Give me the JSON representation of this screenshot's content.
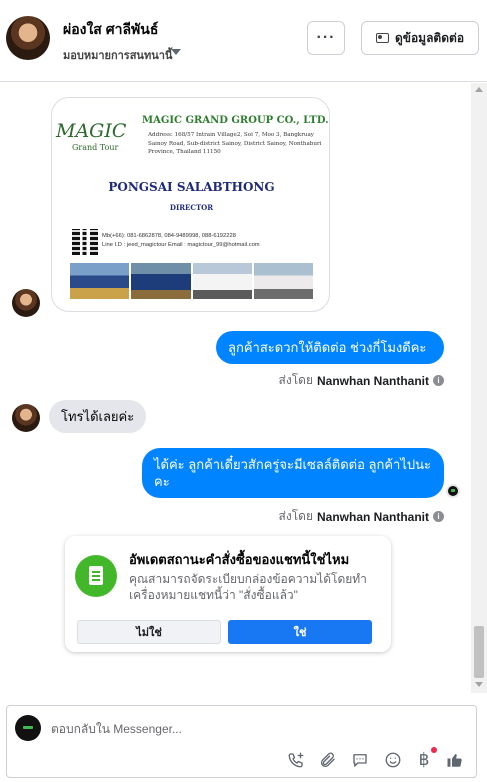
{
  "header": {
    "contact_name": "ผ่องใส ศาลีพันธ์",
    "assignee_label": "มอบหมายการสนทนานี้",
    "more_label": "···",
    "contact_info_label": "ดูข้อมูลติดต่อ"
  },
  "business_card": {
    "logo_text": "MAGIC",
    "logo_sub": "Grand Tour",
    "company": "MAGIC GRAND GROUP CO., LTD.",
    "address": "Address: 168/57 Intrain Village2, Soi 7, Moo 3, Bangkruay Sainoy Road, Sub-district Sainoy, District Sainoy, Nonthaburi Province, Thailand 11150",
    "person": "PONGSAI SALABTHONG",
    "title": "DIRECTOR",
    "phones": "Mb(+66): 081-6862878, 084-9489998, 088-6192228",
    "line_email": "Line I.D : jeed_magictour  Email : magictour_99@hotmail.com"
  },
  "messages": [
    {
      "direction": "out",
      "text": "ลูกค้าสะดวกให้ติดต่อ ช่วงกี่โมงดีคะ"
    },
    {
      "direction": "in",
      "text": "โทรได้เลยค่ะ"
    },
    {
      "direction": "out",
      "text": "ได้ค่ะ ลูกค้าเดี๋ยวสักครู่จะมีเซลล์ติดต่อ ลูกค้าไปนะคะ"
    }
  ],
  "sent_by": {
    "prefix": "ส่งโดย",
    "agent": "Nanwhan Nanthanit",
    "info_icon": "i"
  },
  "order_prompt": {
    "title": "อัพเดตสถานะคำสั่งซื้อของแชทนี้ใช่ไหม",
    "description": "คุณสามารถจัดระเบียบกล่องข้อความได้โดยทำเครื่องหมายแชทนี้ว่า \"สั่งซื้อแล้ว\"",
    "no_label": "ไม่ใช่",
    "yes_label": "ใช่"
  },
  "composer": {
    "placeholder": "ตอบกลับใน Messenger..."
  },
  "icons": [
    "phone-plus-icon",
    "paperclip-icon",
    "speech-bubble-icon",
    "emoji-icon",
    "baht-icon",
    "thumbs-up-icon",
    "info-icon",
    "order-document-icon",
    "contact-card-icon",
    "chevron-down-icon"
  ],
  "colors": {
    "outgoing_bubble": "#0084ff",
    "incoming_bubble": "#e4e6eb",
    "primary_button": "#1877f2",
    "order_icon_bg": "#42b72a"
  }
}
